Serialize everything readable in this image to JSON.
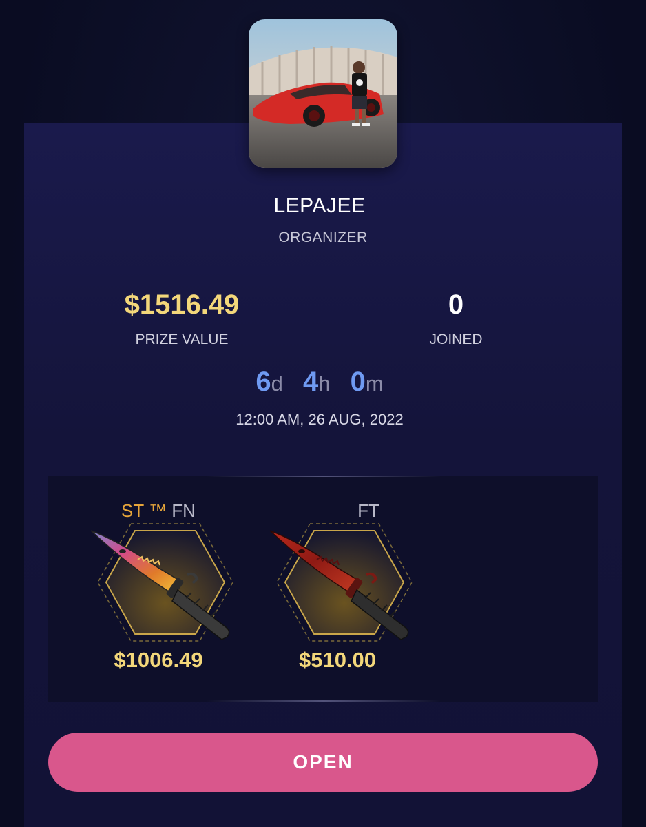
{
  "organizer": {
    "name": "LEPAJEE",
    "role": "ORGANIZER",
    "avatar": "organizer-photo"
  },
  "stats": {
    "prize_value": "$1516.49",
    "prize_label": "PRIZE VALUE",
    "joined_value": "0",
    "joined_label": "JOINED"
  },
  "countdown": {
    "days": "6",
    "days_unit": "d",
    "hours": "4",
    "hours_unit": "h",
    "minutes": "0",
    "minutes_unit": "m"
  },
  "end_date": "12:00 AM, 26 AUG, 2022",
  "items": [
    {
      "tag_stattrak": "ST ™",
      "tag_wear": "FN",
      "price": "$1006.49",
      "icon": "bayonet-fade-knife"
    },
    {
      "tag_stattrak": "",
      "tag_wear": "FT",
      "price": "$510.00",
      "icon": "bayonet-crimson-knife"
    }
  ],
  "actions": {
    "open_label": "OPEN"
  },
  "colors": {
    "background": "#0b0d24",
    "card": "#1a1a4c",
    "gold": "#f3d77a",
    "countdown_blue": "#6f9af2",
    "stattrak_orange": "#e6a53a",
    "button_pink": "#d9578c"
  }
}
